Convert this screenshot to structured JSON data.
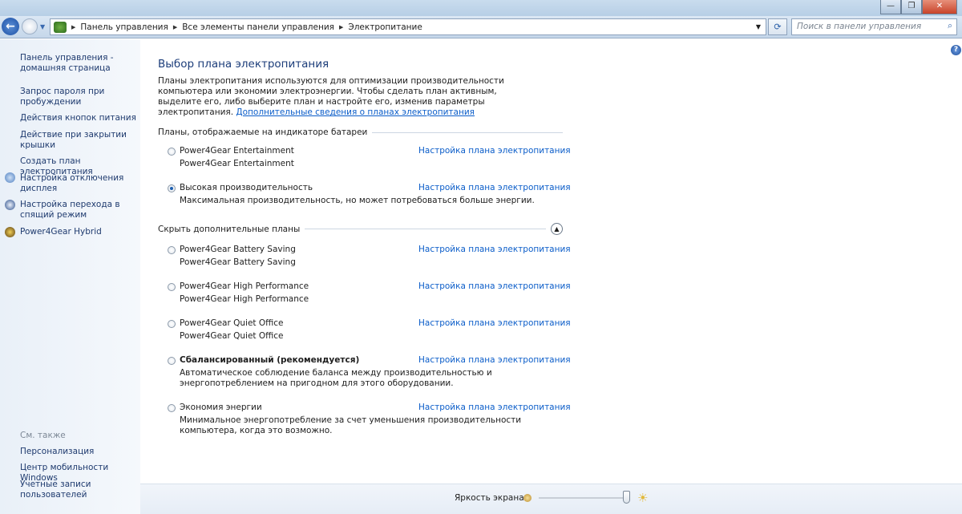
{
  "window": {
    "minimize": "—",
    "maximize": "❐",
    "close": "✕"
  },
  "nav": {
    "breadcrumb": [
      "Панель управления",
      "Все элементы панели управления",
      "Электропитание"
    ],
    "search_placeholder": "Поиск в панели управления"
  },
  "sidebar": {
    "items": [
      {
        "label": "Панель управления - домашняя страница"
      },
      {
        "label": "Запрос пароля при пробуждении"
      },
      {
        "label": "Действия кнопок питания"
      },
      {
        "label": "Действие при закрытии крышки"
      },
      {
        "label": "Создать план электропитания"
      },
      {
        "label": "Настройка отключения дисплея"
      },
      {
        "label": "Настройка перехода в спящий режим"
      },
      {
        "label": "Power4Gear Hybrid"
      }
    ],
    "see_also": "См. также",
    "see_also_items": [
      "Персонализация",
      "Центр мобильности Windows",
      "Учетные записи пользователей"
    ]
  },
  "main": {
    "title": "Выбор плана электропитания",
    "intro": "Планы электропитания используются для оптимизации производительности компьютера или экономии электроэнергии. Чтобы сделать план активным, выделите его, либо выберите план и настройте его, изменив параметры электропитания. ",
    "intro_link": "Дополнительные сведения о планах электропитания",
    "group1": "Планы, отображаемые на индикаторе батареи",
    "group2": "Скрыть дополнительные планы",
    "settings_link": "Настройка плана электропитания",
    "plans1": [
      {
        "name": "Power4Gear Entertainment",
        "desc": "Power4Gear Entertainment",
        "selected": false
      },
      {
        "name": "Высокая производительность",
        "desc": "Максимальная производительность, но может потребоваться больше энергии.",
        "selected": true
      }
    ],
    "plans2": [
      {
        "name": "Power4Gear Battery Saving",
        "desc": "Power4Gear Battery Saving"
      },
      {
        "name": "Power4Gear High Performance",
        "desc": "Power4Gear High Performance"
      },
      {
        "name": "Power4Gear Quiet Office",
        "desc": "Power4Gear Quiet Office"
      },
      {
        "name": "Сбалансированный (рекомендуется)",
        "desc": "Автоматическое соблюдение баланса между производительностью и энергопотреблением на пригодном для этого оборудовании."
      },
      {
        "name": "Экономия энергии",
        "desc": "Минимальное энергопотребление за счет уменьшения производительности компьютера, когда это возможно."
      }
    ]
  },
  "brightness": {
    "label": "Яркость экрана:",
    "value_percent": 100
  }
}
